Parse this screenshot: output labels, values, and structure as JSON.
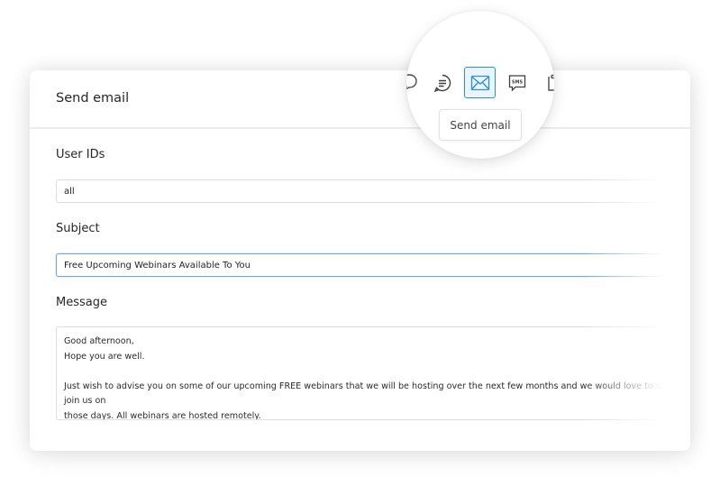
{
  "dialog": {
    "title": "Send email"
  },
  "form": {
    "user_ids": {
      "label": "User IDs",
      "value": "all"
    },
    "subject": {
      "label": "Subject",
      "value": "Free Upcoming Webinars Available To You"
    },
    "message": {
      "label": "Message",
      "value": "Good afternoon,\nHope you are well.\n\nJust wish to advise you on some of our upcoming FREE webinars that we will be hosting over the next few months and we would love to see you join us on\nthose days. All webinars are hosted remotely."
    }
  },
  "toolbar": {
    "icons": [
      "chat-bubble-icon",
      "message-lines-icon",
      "email-icon",
      "sms-icon",
      "clipboard-icon"
    ],
    "sms_glyph": "SMS",
    "active_tooltip": "Send email",
    "accent_color": "#2d8fd0"
  }
}
